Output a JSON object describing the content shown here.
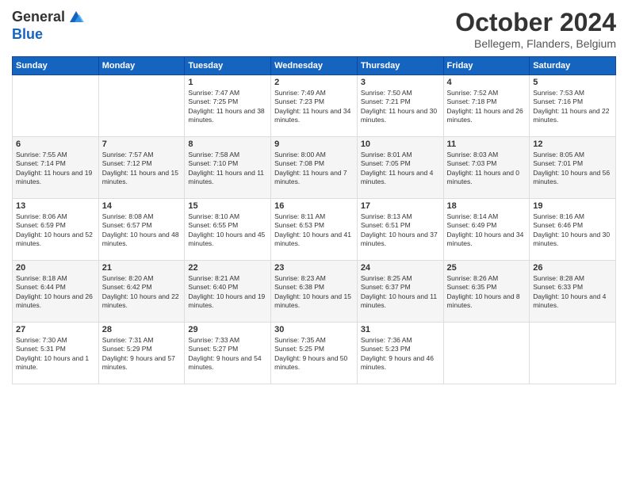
{
  "header": {
    "logo_line1": "General",
    "logo_line2": "Blue",
    "month": "October 2024",
    "location": "Bellegem, Flanders, Belgium"
  },
  "weekdays": [
    "Sunday",
    "Monday",
    "Tuesday",
    "Wednesday",
    "Thursday",
    "Friday",
    "Saturday"
  ],
  "weeks": [
    [
      {
        "day": "",
        "info": ""
      },
      {
        "day": "",
        "info": ""
      },
      {
        "day": "1",
        "info": "Sunrise: 7:47 AM\nSunset: 7:25 PM\nDaylight: 11 hours and 38 minutes."
      },
      {
        "day": "2",
        "info": "Sunrise: 7:49 AM\nSunset: 7:23 PM\nDaylight: 11 hours and 34 minutes."
      },
      {
        "day": "3",
        "info": "Sunrise: 7:50 AM\nSunset: 7:21 PM\nDaylight: 11 hours and 30 minutes."
      },
      {
        "day": "4",
        "info": "Sunrise: 7:52 AM\nSunset: 7:18 PM\nDaylight: 11 hours and 26 minutes."
      },
      {
        "day": "5",
        "info": "Sunrise: 7:53 AM\nSunset: 7:16 PM\nDaylight: 11 hours and 22 minutes."
      }
    ],
    [
      {
        "day": "6",
        "info": "Sunrise: 7:55 AM\nSunset: 7:14 PM\nDaylight: 11 hours and 19 minutes."
      },
      {
        "day": "7",
        "info": "Sunrise: 7:57 AM\nSunset: 7:12 PM\nDaylight: 11 hours and 15 minutes."
      },
      {
        "day": "8",
        "info": "Sunrise: 7:58 AM\nSunset: 7:10 PM\nDaylight: 11 hours and 11 minutes."
      },
      {
        "day": "9",
        "info": "Sunrise: 8:00 AM\nSunset: 7:08 PM\nDaylight: 11 hours and 7 minutes."
      },
      {
        "day": "10",
        "info": "Sunrise: 8:01 AM\nSunset: 7:05 PM\nDaylight: 11 hours and 4 minutes."
      },
      {
        "day": "11",
        "info": "Sunrise: 8:03 AM\nSunset: 7:03 PM\nDaylight: 11 hours and 0 minutes."
      },
      {
        "day": "12",
        "info": "Sunrise: 8:05 AM\nSunset: 7:01 PM\nDaylight: 10 hours and 56 minutes."
      }
    ],
    [
      {
        "day": "13",
        "info": "Sunrise: 8:06 AM\nSunset: 6:59 PM\nDaylight: 10 hours and 52 minutes."
      },
      {
        "day": "14",
        "info": "Sunrise: 8:08 AM\nSunset: 6:57 PM\nDaylight: 10 hours and 48 minutes."
      },
      {
        "day": "15",
        "info": "Sunrise: 8:10 AM\nSunset: 6:55 PM\nDaylight: 10 hours and 45 minutes."
      },
      {
        "day": "16",
        "info": "Sunrise: 8:11 AM\nSunset: 6:53 PM\nDaylight: 10 hours and 41 minutes."
      },
      {
        "day": "17",
        "info": "Sunrise: 8:13 AM\nSunset: 6:51 PM\nDaylight: 10 hours and 37 minutes."
      },
      {
        "day": "18",
        "info": "Sunrise: 8:14 AM\nSunset: 6:49 PM\nDaylight: 10 hours and 34 minutes."
      },
      {
        "day": "19",
        "info": "Sunrise: 8:16 AM\nSunset: 6:46 PM\nDaylight: 10 hours and 30 minutes."
      }
    ],
    [
      {
        "day": "20",
        "info": "Sunrise: 8:18 AM\nSunset: 6:44 PM\nDaylight: 10 hours and 26 minutes."
      },
      {
        "day": "21",
        "info": "Sunrise: 8:20 AM\nSunset: 6:42 PM\nDaylight: 10 hours and 22 minutes."
      },
      {
        "day": "22",
        "info": "Sunrise: 8:21 AM\nSunset: 6:40 PM\nDaylight: 10 hours and 19 minutes."
      },
      {
        "day": "23",
        "info": "Sunrise: 8:23 AM\nSunset: 6:38 PM\nDaylight: 10 hours and 15 minutes."
      },
      {
        "day": "24",
        "info": "Sunrise: 8:25 AM\nSunset: 6:37 PM\nDaylight: 10 hours and 11 minutes."
      },
      {
        "day": "25",
        "info": "Sunrise: 8:26 AM\nSunset: 6:35 PM\nDaylight: 10 hours and 8 minutes."
      },
      {
        "day": "26",
        "info": "Sunrise: 8:28 AM\nSunset: 6:33 PM\nDaylight: 10 hours and 4 minutes."
      }
    ],
    [
      {
        "day": "27",
        "info": "Sunrise: 7:30 AM\nSunset: 5:31 PM\nDaylight: 10 hours and 1 minute."
      },
      {
        "day": "28",
        "info": "Sunrise: 7:31 AM\nSunset: 5:29 PM\nDaylight: 9 hours and 57 minutes."
      },
      {
        "day": "29",
        "info": "Sunrise: 7:33 AM\nSunset: 5:27 PM\nDaylight: 9 hours and 54 minutes."
      },
      {
        "day": "30",
        "info": "Sunrise: 7:35 AM\nSunset: 5:25 PM\nDaylight: 9 hours and 50 minutes."
      },
      {
        "day": "31",
        "info": "Sunrise: 7:36 AM\nSunset: 5:23 PM\nDaylight: 9 hours and 46 minutes."
      },
      {
        "day": "",
        "info": ""
      },
      {
        "day": "",
        "info": ""
      }
    ]
  ]
}
